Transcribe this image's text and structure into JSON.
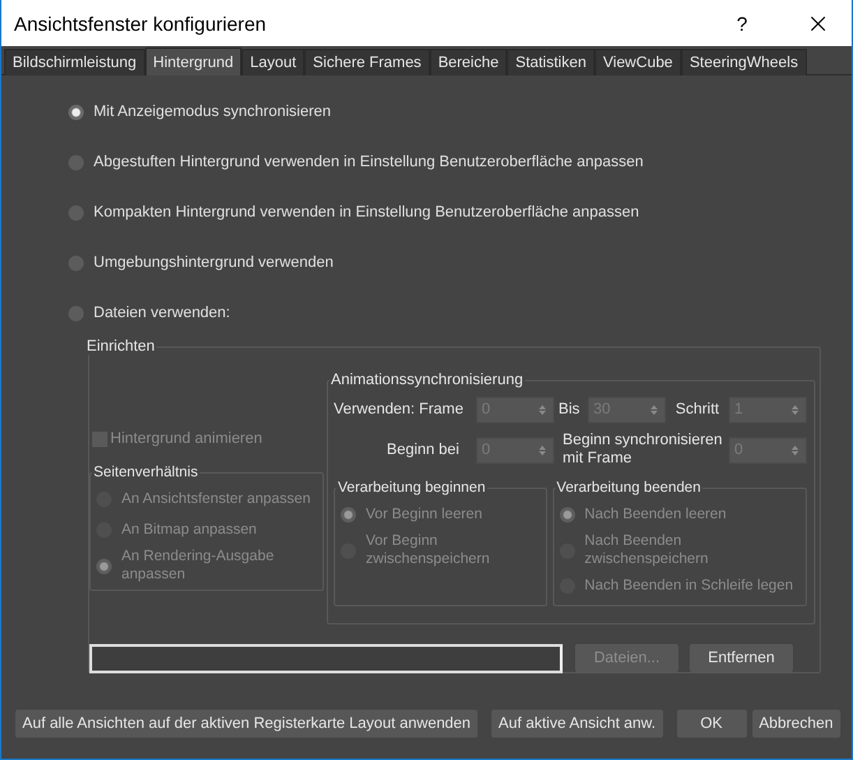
{
  "window": {
    "title": "Ansichtsfenster konfigurieren",
    "help": "?"
  },
  "tabs": [
    {
      "label": "Bildschirmleistung",
      "selected": false
    },
    {
      "label": "Hintergrund",
      "selected": true
    },
    {
      "label": "Layout",
      "selected": false
    },
    {
      "label": "Sichere Frames",
      "selected": false
    },
    {
      "label": "Bereiche",
      "selected": false
    },
    {
      "label": "Statistiken",
      "selected": false
    },
    {
      "label": "ViewCube",
      "selected": false
    },
    {
      "label": "SteeringWheels",
      "selected": false
    }
  ],
  "background_options": [
    {
      "label": "Mit Anzeigemodus synchronisieren",
      "selected": true
    },
    {
      "label": "Abgestuften Hintergrund verwenden in Einstellung Benutzeroberfläche anpassen",
      "selected": false
    },
    {
      "label": "Kompakten Hintergrund verwenden in Einstellung Benutzeroberfläche anpassen",
      "selected": false
    },
    {
      "label": "Umgebungshintergrund verwenden",
      "selected": false
    },
    {
      "label": "Dateien verwenden:",
      "selected": false
    }
  ],
  "setup": {
    "title": "Einrichten",
    "animate": {
      "label": "Hintergrund animieren",
      "checked": false,
      "disabled": true
    },
    "aspect_ratio": {
      "title": "Seitenverhältnis",
      "disabled": true,
      "options": [
        {
          "label": "An Ansichtsfenster anpassen",
          "selected": false
        },
        {
          "label": "An Bitmap anpassen",
          "selected": false
        },
        {
          "label": "An Rendering-Ausgabe anpassen",
          "selected": true
        }
      ]
    },
    "anim_sync": {
      "title": "Animationssynchronisierung",
      "row_1": [
        {
          "label": "Verwenden: Frame",
          "value": "0"
        },
        {
          "label": "Bis",
          "value": "30"
        },
        {
          "label": "Schritt",
          "value": "1"
        }
      ],
      "row_2": [
        {
          "label": "Beginn bei",
          "value": "0"
        },
        {
          "label": "Beginn synchronisieren mit Frame",
          "value": "0"
        }
      ],
      "start_processing": {
        "title": "Verarbeitung beginnen",
        "disabled": true,
        "options": [
          {
            "label": "Vor Beginn leeren",
            "selected": true
          },
          {
            "label": "Vor Beginn zwischenspeichern",
            "selected": false
          }
        ]
      },
      "end_processing": {
        "title": "Verarbeitung beenden",
        "disabled": true,
        "options": [
          {
            "label": "Nach Beenden leeren",
            "selected": true
          },
          {
            "label": "Nach Beenden zwischenspeichern",
            "selected": false
          },
          {
            "label": "Nach Beenden in Schleife legen",
            "selected": false
          }
        ]
      }
    },
    "files_button": {
      "label": "Dateien...",
      "disabled": true
    },
    "remove_button": {
      "label": "Entfernen",
      "disabled": false
    }
  },
  "buttons": [
    {
      "label": "Auf alle Ansichten auf der aktiven Registerkarte Layout anwenden"
    },
    {
      "label": "Auf aktive Ansicht anw."
    },
    {
      "label": "OK"
    },
    {
      "label": "Abbrechen"
    }
  ]
}
